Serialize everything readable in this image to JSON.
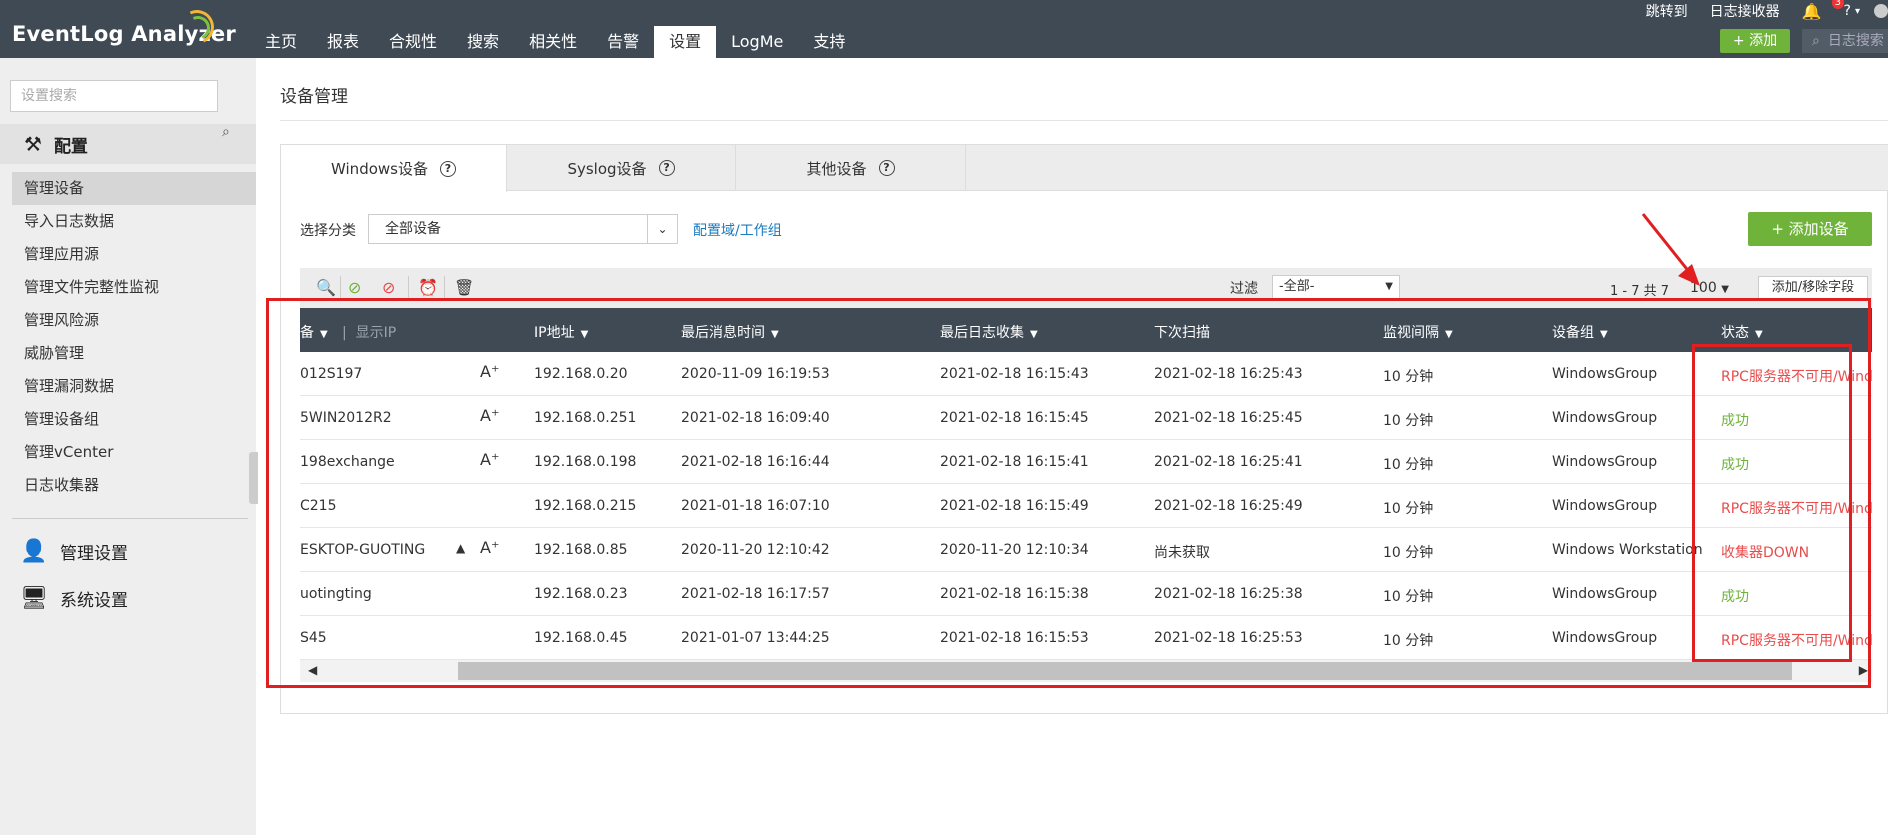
{
  "app": {
    "logo": "EventLog Analyzer"
  },
  "nav": {
    "items": [
      "主页",
      "报表",
      "合规性",
      "搜索",
      "相关性",
      "告警",
      "设置",
      "LogMe",
      "支持"
    ],
    "active_index": 6
  },
  "top_links": {
    "jump": "跳转到",
    "receiver": "日志接收器",
    "bell_count": "3",
    "help": "?"
  },
  "top": {
    "add_label": "+ 添加",
    "search_placeholder": "日志搜索"
  },
  "sidebar": {
    "search_placeholder": "设置搜索",
    "section_config": "配置",
    "items": [
      "管理设备",
      "导入日志数据",
      "管理应用源",
      "管理文件完整性监视",
      "管理风险源",
      "威胁管理",
      "管理漏洞数据",
      "管理设备组",
      "管理vCenter",
      "日志收集器"
    ],
    "active_index": 0,
    "section_manage": "管理设置",
    "section_system": "系统设置"
  },
  "main": {
    "title": "设备管理",
    "tabs": [
      "Windows设备",
      "Syslog设备",
      "其他设备"
    ],
    "filter_label": "选择分类",
    "filter_value": "全部设备",
    "domain_link": "配置域/工作组",
    "add_device": "+ 添加设备",
    "toolbar": {
      "filter_label": "过滤",
      "filter_value": "-全部-",
      "count": "1 - 7 共 7",
      "page_size": "100",
      "fields_btn": "添加/移除字段"
    }
  },
  "grid": {
    "headers": [
      "备",
      "显示IP",
      "IP地址",
      "最后消息时间",
      "最后日志收集",
      "下次扫描",
      "监视间隔",
      "设备组",
      "状态"
    ],
    "rows": [
      {
        "device": "012S197",
        "ip": "192.168.0.20",
        "last_msg": "2020-11-09 16:19:53",
        "last_collect": "2021-02-18 16:15:43",
        "next_scan": "2021-02-18 16:25:43",
        "interval": "10 分钟",
        "group": "WindowsGroup",
        "status": "RPC服务器不可用/Windo",
        "status_type": "error",
        "icons": 1
      },
      {
        "device": "5WIN2012R2",
        "ip": "192.168.0.251",
        "last_msg": "2021-02-18 16:09:40",
        "last_collect": "2021-02-18 16:15:45",
        "next_scan": "2021-02-18 16:25:45",
        "interval": "10 分钟",
        "group": "WindowsGroup",
        "status": "成功",
        "status_type": "ok",
        "icons": 1
      },
      {
        "device": "198exchange",
        "ip": "192.168.0.198",
        "last_msg": "2021-02-18 16:16:44",
        "last_collect": "2021-02-18 16:15:41",
        "next_scan": "2021-02-18 16:25:41",
        "interval": "10 分钟",
        "group": "WindowsGroup",
        "status": "成功",
        "status_type": "ok",
        "icons": 1
      },
      {
        "device": "C215",
        "ip": "192.168.0.215",
        "last_msg": "2021-01-18 16:07:10",
        "last_collect": "2021-02-18 16:15:49",
        "next_scan": "2021-02-18 16:25:49",
        "interval": "10 分钟",
        "group": "WindowsGroup",
        "status": "RPC服务器不可用/Windo",
        "status_type": "error",
        "icons": 0
      },
      {
        "device": "ESKTOP-GUOTING",
        "ip": "192.168.0.85",
        "last_msg": "2020-11-20 12:10:42",
        "last_collect": "2020-11-20 12:10:34",
        "next_scan": "尚未获取",
        "interval": "10 分钟",
        "group": "Windows Workstation",
        "status": "收集器DOWN",
        "status_type": "error",
        "icons": 2
      },
      {
        "device": "uotingting",
        "ip": "192.168.0.23",
        "last_msg": "2021-02-18 16:17:57",
        "last_collect": "2021-02-18 16:15:38",
        "next_scan": "2021-02-18 16:25:38",
        "interval": "10 分钟",
        "group": "WindowsGroup",
        "status": "成功",
        "status_type": "ok",
        "icons": 0
      },
      {
        "device": "S45",
        "ip": "192.168.0.45",
        "last_msg": "2021-01-07 13:44:25",
        "last_collect": "2021-02-18 16:15:53",
        "next_scan": "2021-02-18 16:25:53",
        "interval": "10 分钟",
        "group": "WindowsGroup",
        "status": "RPC服务器不可用/Windo",
        "status_type": "error",
        "icons": 0
      }
    ]
  },
  "colors": {
    "topbar": "#3f4a55",
    "accent_green": "#6fb33b",
    "error_red": "#e84c4c",
    "link_blue": "#1a7bbf",
    "annotation_red": "#e02020"
  }
}
